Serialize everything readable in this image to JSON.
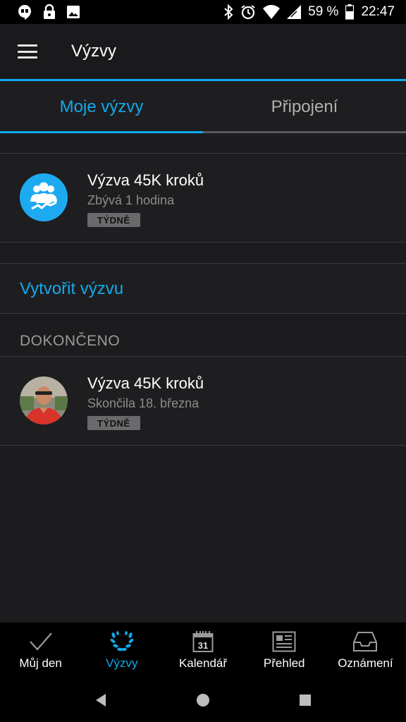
{
  "status_bar": {
    "battery": "59 %",
    "time": "22:47",
    "icons_left": [
      "hangouts-icon",
      "lock-icon",
      "image-icon"
    ],
    "icons_right": [
      "bluetooth-icon",
      "alarm-icon",
      "wifi-icon",
      "signal-icon",
      "battery-icon"
    ]
  },
  "app_bar": {
    "title": "Výzvy"
  },
  "tabs": [
    {
      "label": "Moje výzvy",
      "active": true
    },
    {
      "label": "Připojení",
      "active": false
    }
  ],
  "active_challenges": [
    {
      "title": "Výzva 45K kroků",
      "subtitle": "Zbývá 1 hodina",
      "badge": "TÝDNĚ",
      "icon": "group-challenge-icon"
    }
  ],
  "create_challenge": {
    "label": "Vytvořit výzvu"
  },
  "completed_section": {
    "header": "DOKONČENO",
    "items": [
      {
        "title": "Výzva 45K kroků",
        "subtitle": "Skončila 18. března",
        "badge": "TÝDNĚ",
        "icon": "user-avatar"
      }
    ]
  },
  "bottom_nav": [
    {
      "label": "Můj den",
      "icon": "checkmark-icon",
      "active": false
    },
    {
      "label": "Výzvy",
      "icon": "laurel-icon",
      "active": true
    },
    {
      "label": "Kalendář",
      "icon": "calendar-icon",
      "calendar_day": "31",
      "active": false
    },
    {
      "label": "Přehled",
      "icon": "newspaper-icon",
      "active": false
    },
    {
      "label": "Oznámení",
      "icon": "inbox-icon",
      "active": false
    }
  ],
  "colors": {
    "accent": "#11a9ed",
    "background": "#1c1c1e",
    "badge": "#6a6a6c"
  }
}
